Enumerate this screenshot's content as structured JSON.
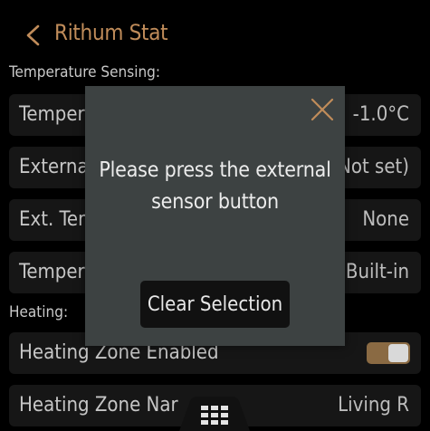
{
  "header": {
    "back_icon": "chevron-left-icon",
    "title": "Rithum Stat"
  },
  "colors": {
    "accent": "#c08c5a",
    "background": "#000000",
    "row_background": "#161616",
    "modal_background": "#3d4242"
  },
  "sections": {
    "temperature_sensing": {
      "label": "Temperature Sensing:",
      "rows": [
        {
          "label": "Temper",
          "value": "-1.0°C"
        },
        {
          "label": "Externa",
          "value": "Not set)"
        },
        {
          "label": "Ext. Tem",
          "value": "None"
        },
        {
          "label": "Temper",
          "value": "Built-in"
        }
      ]
    },
    "heating": {
      "label": "Heating:",
      "rows": [
        {
          "label": "Heating Zone Enabled",
          "toggle_on": true
        },
        {
          "label": "Heating Zone Nar",
          "value": "Living R"
        }
      ]
    }
  },
  "modal": {
    "close_icon": "close-icon",
    "message_line1": "Please press the external",
    "message_line2": "sensor button",
    "button_label": "Clear Selection"
  },
  "bottom_tab": {
    "icon": "grid-menu-icon"
  }
}
